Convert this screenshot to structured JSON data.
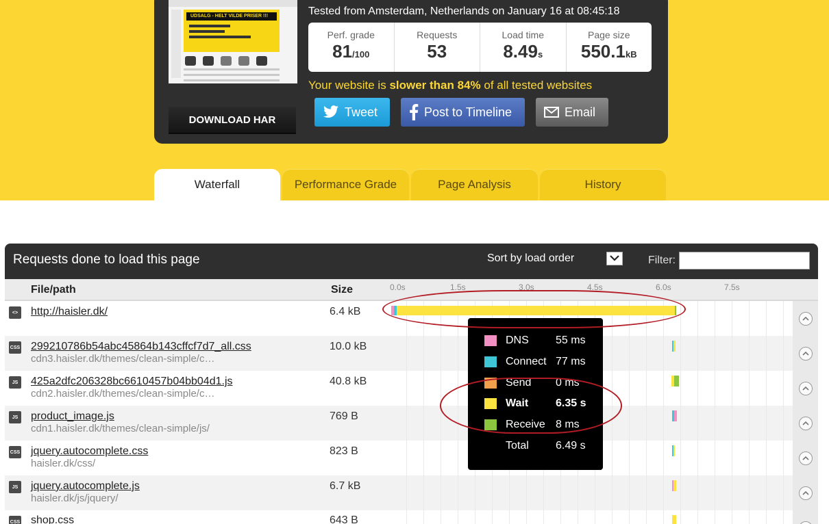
{
  "summary": {
    "tested_from": "Tested from Amsterdam, Netherlands on January 16 at 08:45:18",
    "download_har": "DOWNLOAD HAR",
    "thumbnail_banner": "UDSALG - HELT VILDE PRISER !!!",
    "stats": [
      {
        "label": "Perf. grade",
        "value": "81",
        "unit": "/100"
      },
      {
        "label": "Requests",
        "value": "53",
        "unit": ""
      },
      {
        "label": "Load time",
        "value": "8.49",
        "unit": "s"
      },
      {
        "label": "Page size",
        "value": "550.1",
        "unit": "kB"
      }
    ],
    "slower_prefix": "Your website is ",
    "slower_bold": "slower than 84%",
    "slower_suffix": " of all tested websites",
    "share": {
      "tweet": "Tweet",
      "facebook": "Post to Timeline",
      "email": "Email"
    }
  },
  "tabs": [
    {
      "label": "Waterfall",
      "active": true
    },
    {
      "label": "Performance Grade",
      "active": false
    },
    {
      "label": "Page Analysis",
      "active": false
    },
    {
      "label": "History",
      "active": false
    }
  ],
  "requests": {
    "title": "Requests done to load this page",
    "sort_label": "Sort by load order",
    "filter_label": "Filter:",
    "filter_value": "",
    "columns": {
      "file": "File/path",
      "size": "Size"
    },
    "timeline_ticks": [
      "0.0s",
      "1.5s",
      "3.0s",
      "4.5s",
      "6.0s",
      "7.5s"
    ],
    "rows": [
      {
        "type": "html",
        "name": "http://haisler.dk/",
        "host": "",
        "size": "6.4 kB"
      },
      {
        "type": "css",
        "name": "299210786b54abc45864b143cffcf7d7_all.css",
        "host": "cdn3.haisler.dk/themes/clean-simple/c…",
        "size": "10.0 kB"
      },
      {
        "type": "js",
        "name": "425a2dfc206328bc6610457b04bb04d1.js",
        "host": "cdn2.haisler.dk/themes/clean-simple/c…",
        "size": "40.8 kB"
      },
      {
        "type": "js",
        "name": "product_image.js",
        "host": "cdn1.haisler.dk/themes/clean-simple/js/",
        "size": "769 B"
      },
      {
        "type": "css",
        "name": "jquery.autocomplete.css",
        "host": "haisler.dk/css/",
        "size": "823 B"
      },
      {
        "type": "js",
        "name": "jquery.autocomplete.js",
        "host": "haisler.dk/js/jquery/",
        "size": "6.7 kB"
      },
      {
        "type": "css",
        "name": "shop.css",
        "host": "",
        "size": "643 B"
      }
    ]
  },
  "tooltip": [
    {
      "label": "DNS",
      "value": "55 ms",
      "color": "#f28fc3"
    },
    {
      "label": "Connect",
      "value": "77 ms",
      "color": "#3fc6d6"
    },
    {
      "label": "Send",
      "value": "0 ms",
      "color": "#f0a04a"
    },
    {
      "label": "Wait",
      "value": "6.35 s",
      "color": "#fce33f"
    },
    {
      "label": "Receive",
      "value": "8 ms",
      "color": "#8cc63f"
    },
    {
      "label": "Total",
      "value": "6.49 s",
      "color": ""
    }
  ],
  "colors": {
    "brand_yellow": "#fcd733",
    "dark_panel": "#2f2f2f",
    "annotation_red": "#b31c24"
  }
}
